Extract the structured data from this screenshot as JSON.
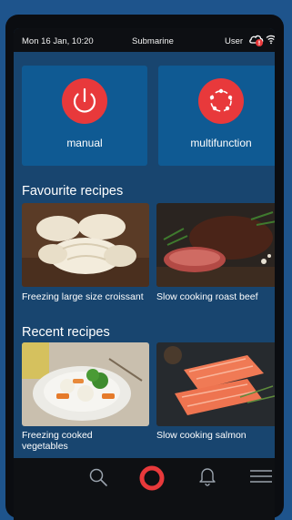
{
  "status_bar": {
    "datetime": "Mon 16 Jan, 10:20",
    "mode": "Submarine",
    "user": "User",
    "icons": [
      "cloud-alert-icon",
      "wifi-icon"
    ]
  },
  "modes": [
    {
      "label": "manual",
      "icon": "power-icon"
    },
    {
      "label": "multifunction",
      "icon": "cycle-icon"
    }
  ],
  "favourites": {
    "title": "Favourite recipes",
    "items": [
      {
        "label": "Freezing large size croissant"
      },
      {
        "label": "Slow cooking roast beef"
      }
    ]
  },
  "recent": {
    "title": "Recent recipes",
    "items": [
      {
        "label": "Freezing cooked vegetables"
      },
      {
        "label": "Slow cooking salmon"
      }
    ]
  },
  "nav": {
    "items": [
      "search-icon",
      "home-icon",
      "bell-icon",
      "menu-icon"
    ],
    "accent": "#e8393b"
  },
  "colors": {
    "accent": "#e8393b",
    "tile": "#0f5a93",
    "screen": "#18456f"
  }
}
